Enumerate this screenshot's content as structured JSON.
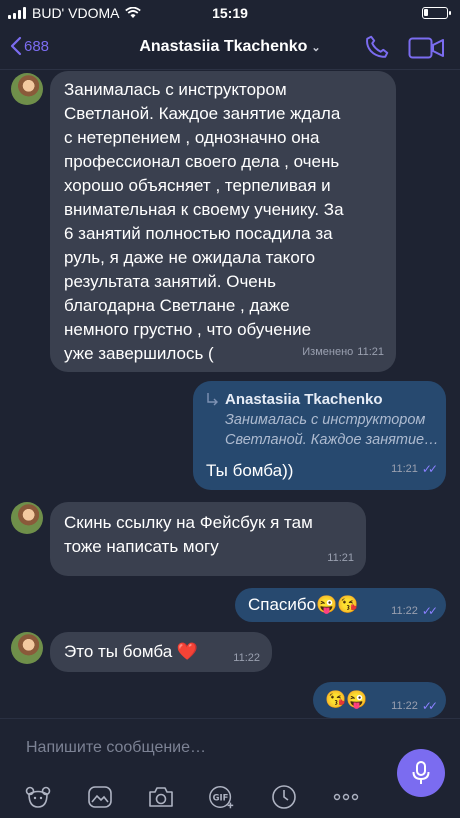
{
  "status_bar": {
    "carrier": "BUD' VDOMA",
    "time": "15:19"
  },
  "header": {
    "back_count": "688",
    "contact_name": "Anastasiia Tkachenko"
  },
  "messages": [
    {
      "direction": "incoming",
      "text": "Занималась с инструктором\nСветланой. Каждое занятие ждала\nс нетерпением , однозначно она\nпрофессионал своего дела , очень\nхорошо объясняет , терпеливая и\nвнимательная к своему ученику. За\n6 занятий полностью посадила за\nруль, я даже не ожидала такого\nрезультата занятий. Очень\nблагодарна Светлане , даже\nнемного грустно , что обучение\nуже завершилось (",
      "edited": "Изменено",
      "time": "11:21"
    },
    {
      "direction": "outgoing",
      "reply_author": "Anastasiia Tkachenko",
      "reply_preview": "Занималась с инструктором\nСветланой. Каждое занятие…",
      "text": "Ты бомба))",
      "time": "11:21"
    },
    {
      "direction": "incoming",
      "text": "Скинь ссылку на Фейсбук я там\nтоже написать могу",
      "time": "11:21"
    },
    {
      "direction": "outgoing",
      "text": "Спасибо😜😘",
      "time": "11:22"
    },
    {
      "direction": "incoming",
      "text": "Это ты бомба ❤️",
      "time": "11:22"
    },
    {
      "direction": "outgoing",
      "text": "😘😜",
      "time": "11:22"
    }
  ],
  "composer": {
    "placeholder": "Напишите сообщение…"
  },
  "colors": {
    "accent": "#7b6cf0",
    "incoming_bubble": "#3a404f",
    "outgoing_bubble": "#27496f",
    "background": "#1e2332"
  },
  "icons": [
    "signal-icon",
    "wifi-icon",
    "battery-icon",
    "back-chevron-icon",
    "phone-icon",
    "video-icon",
    "sticker-icon",
    "gallery-icon",
    "camera-icon",
    "gif-icon",
    "clock-icon",
    "more-icon",
    "microphone-icon",
    "read-ticks-icon",
    "reply-arrow-icon"
  ]
}
